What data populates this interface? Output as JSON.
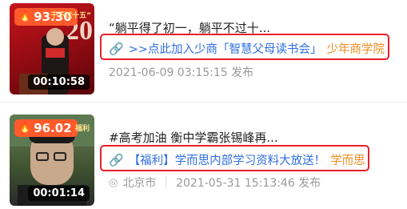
{
  "items": [
    {
      "score": "93.30",
      "duration": "00:10:58",
      "title": "“躺平得了初一，躺平不过十...",
      "link_text": ">>点此加入少商「智慧父母读书会」",
      "source_tag": "少年商学院",
      "location": "",
      "date": "2021-06-09 03:15:15 发布",
      "thumb_caption": "干不过十五”",
      "thumb_bg": "#b0101a"
    },
    {
      "score": "96.02",
      "duration": "00:01:14",
      "title": "#高考加油 衡中学霸张锡峰再...",
      "link_text": "【福利】学而思内部学习资料大放送！",
      "source_tag": "学而思",
      "location": "北京市",
      "date": "2021-05-31 15:13:46 发布",
      "thumb_caption": "福利",
      "thumb_bg": "#4a6b3a"
    }
  ]
}
